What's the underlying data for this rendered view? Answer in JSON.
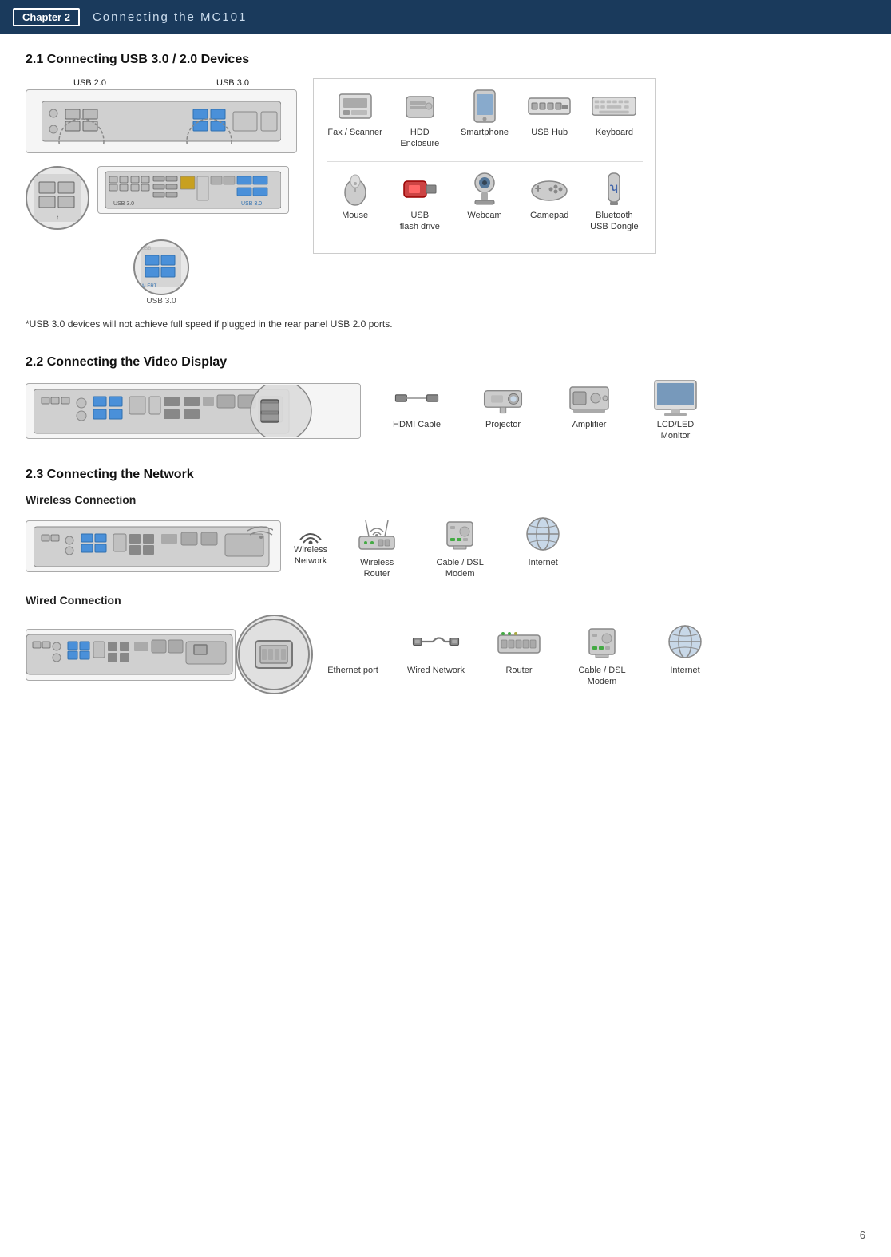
{
  "header": {
    "chapter_label": "Chapter 2",
    "title": "Connecting the MC101"
  },
  "section21": {
    "heading": "2.1 Connecting USB 3.0 / 2.0 Devices",
    "usb_labels": [
      "USB 2.0",
      "USB 3.0"
    ],
    "usb30_label": "USB 3.0",
    "note": "*USB 3.0 devices will not achieve full speed if plugged in the rear panel USB 2.0 ports.",
    "devices_row1": [
      {
        "label": "Fax / Scanner"
      },
      {
        "label": "HDD Enclosure"
      },
      {
        "label": "Smartphone"
      },
      {
        "label": "USB Hub"
      },
      {
        "label": "Keyboard"
      }
    ],
    "devices_row2": [
      {
        "label": "Mouse"
      },
      {
        "label": "USB\nflash drive"
      },
      {
        "label": "Webcam"
      },
      {
        "label": "Gamepad"
      },
      {
        "label": "Bluetooth\nUSB Dongle"
      }
    ]
  },
  "section22": {
    "heading": "2.2 Connecting the Video Display",
    "devices": [
      {
        "label": "HDMI Cable"
      },
      {
        "label": "Projector"
      },
      {
        "label": "Amplifier"
      },
      {
        "label": "LCD/LED\nMonitor"
      }
    ]
  },
  "section23": {
    "heading": "2.3 Connecting the Network",
    "wireless_heading": "Wireless Connection",
    "wired_heading": "Wired Connection",
    "wireless_label": "Wireless\nNetwork",
    "wireless_devices": [
      {
        "label": "Wireless\nRouter"
      },
      {
        "label": "Cable / DSL\nModem"
      },
      {
        "label": "Internet"
      }
    ],
    "wired_devices": [
      {
        "label": "Ethernet port"
      },
      {
        "label": "Wired Network"
      },
      {
        "label": "Router"
      },
      {
        "label": "Cable / DSL\nModem"
      },
      {
        "label": "Internet"
      }
    ]
  },
  "page_number": "6"
}
